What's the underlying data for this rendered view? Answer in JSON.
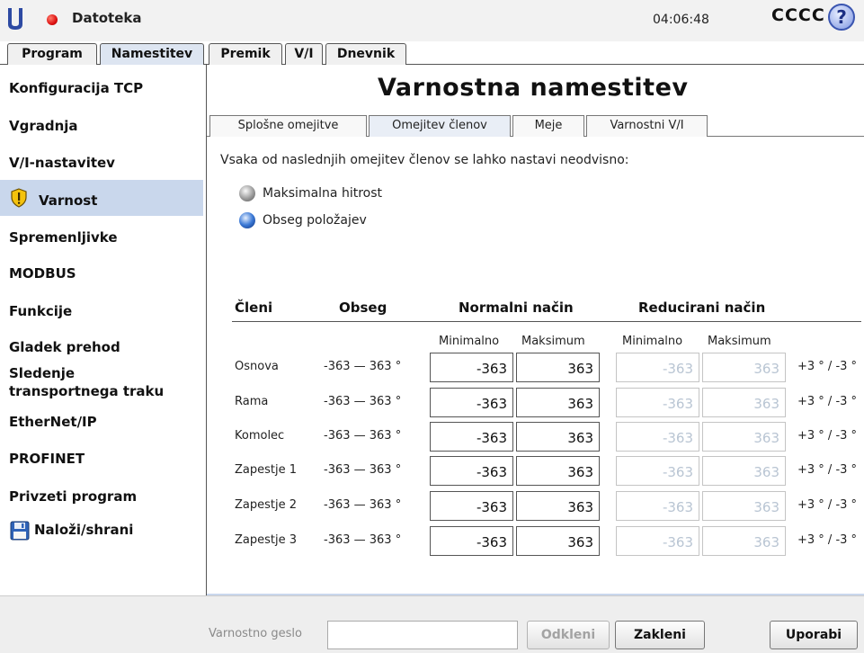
{
  "header": {
    "app_menu_label": "Datoteka",
    "time": "04:06:48",
    "robot_name": "CCCC",
    "help_label": "?"
  },
  "main_tabs": [
    {
      "label": "Program"
    },
    {
      "label": "Namestitev",
      "active": true
    },
    {
      "label": "Premik"
    },
    {
      "label": "V/I"
    },
    {
      "label": "Dnevnik"
    }
  ],
  "sidebar": {
    "items": [
      {
        "label": "Konfiguracija TCP"
      },
      {
        "label": "Vgradnja"
      },
      {
        "label": "V/I-nastavitev"
      },
      {
        "label": "Varnost",
        "active": true,
        "icon": "warning-shield-icon"
      },
      {
        "label": "Spremenljivke"
      },
      {
        "label": "MODBUS"
      },
      {
        "label": "Funkcije"
      },
      {
        "label": "Gladek prehod"
      },
      {
        "label": "Sledenje transportnega traku",
        "line1": "Sledenje",
        "line2": "transportnega traku"
      },
      {
        "label": "EtherNet/IP"
      },
      {
        "label": "PROFINET"
      },
      {
        "label": "Privzeti program"
      },
      {
        "label": "Naloži/shrani",
        "icon": "floppy-disk-icon"
      }
    ]
  },
  "panel": {
    "title": "Varnostna namestitev",
    "sub_tabs": [
      {
        "label": "Splošne omejitve"
      },
      {
        "label": "Omejitev členov",
        "active": true
      },
      {
        "label": "Meje"
      },
      {
        "label": "Varnostni V/I"
      }
    ],
    "intro": "Vsaka od naslednjih omejitev členov se lahko nastavi neodvisno:",
    "options": [
      {
        "label": "Maksimalna hitrost",
        "selected": false
      },
      {
        "label": "Obseg položajev",
        "selected": true
      }
    ],
    "table": {
      "headers": {
        "joints": "Členi",
        "range": "Obseg",
        "normal": "Normalni način",
        "reduced": "Reducirani način"
      },
      "subheaders": {
        "normal_min": "Minimalno",
        "normal_max": "Maksimum",
        "reduced_min": "Minimalno",
        "reduced_max": "Maksimum"
      },
      "rows": [
        {
          "name": "Osnova",
          "range": "-363 — 363 °",
          "normal_min": "-363",
          "normal_max": "363",
          "reduced_min": "-363",
          "reduced_max": "363",
          "tolerance": "+3 ° / -3 °"
        },
        {
          "name": "Rama",
          "range": "-363 — 363 °",
          "normal_min": "-363",
          "normal_max": "363",
          "reduced_min": "-363",
          "reduced_max": "363",
          "tolerance": "+3 ° / -3 °"
        },
        {
          "name": "Komolec",
          "range": "-363 — 363 °",
          "normal_min": "-363",
          "normal_max": "363",
          "reduced_min": "-363",
          "reduced_max": "363",
          "tolerance": "+3 ° / -3 °"
        },
        {
          "name": "Zapestje 1",
          "range": "-363 — 363 °",
          "normal_min": "-363",
          "normal_max": "363",
          "reduced_min": "-363",
          "reduced_max": "363",
          "tolerance": "+3 ° / -3 °"
        },
        {
          "name": "Zapestje 2",
          "range": "-363 — 363 °",
          "normal_min": "-363",
          "normal_max": "363",
          "reduced_min": "-363",
          "reduced_max": "363",
          "tolerance": "+3 ° / -3 °"
        },
        {
          "name": "Zapestje 3",
          "range": "-363 — 363 °",
          "normal_min": "-363",
          "normal_max": "363",
          "reduced_min": "-363",
          "reduced_max": "363",
          "tolerance": "+3 ° / -3 °"
        }
      ]
    }
  },
  "footer": {
    "password_label": "Varnostno geslo",
    "password_value": "",
    "unlock_label": "Odkleni",
    "lock_label": "Zakleni",
    "apply_label": "Uporabi"
  },
  "colors": {
    "active_tab": "#dde5f1",
    "active_sidebar": "#c9d7ec",
    "disabled_text": "#b9c5d3",
    "record_dot": "#dd1111",
    "help_blue": "#3a55b0"
  }
}
